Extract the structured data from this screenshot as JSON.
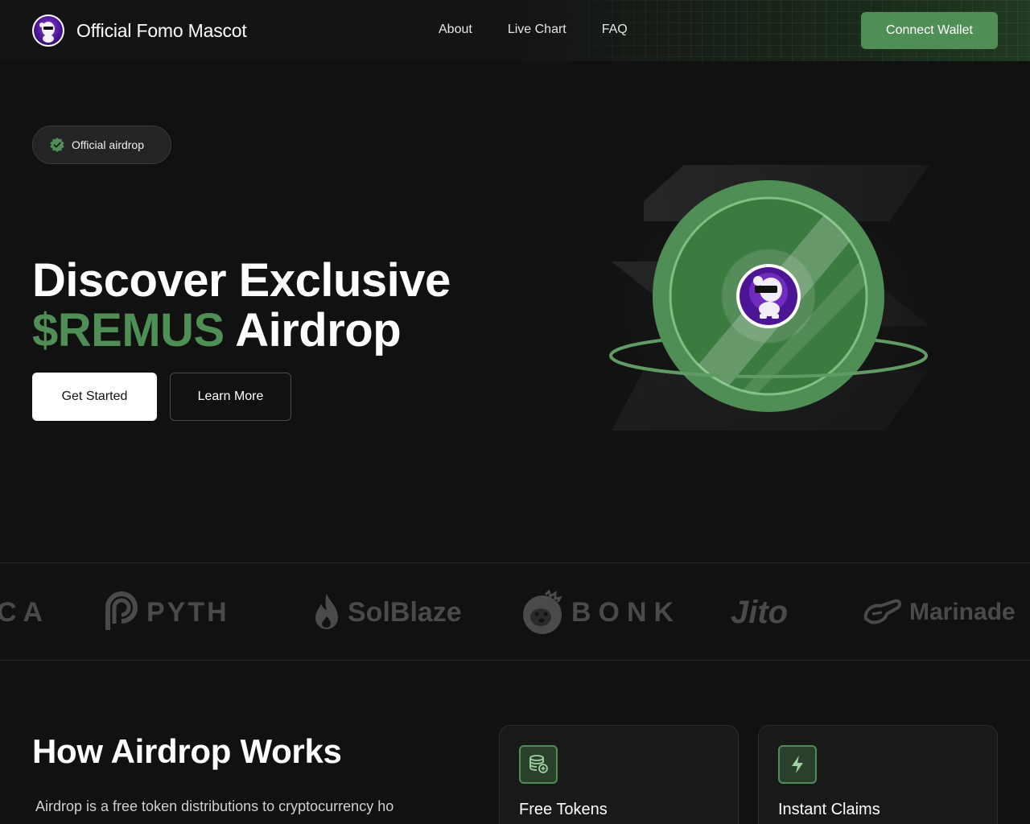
{
  "header": {
    "brand": "Official Fomo Mascot",
    "nav": [
      {
        "label": "About"
      },
      {
        "label": "Live Chart"
      },
      {
        "label": "FAQ"
      }
    ],
    "connect_label": "Connect Wallet"
  },
  "hero": {
    "badge": "Official airdrop",
    "title_line1": "Discover Exclusive",
    "title_accent": "$REMUS",
    "title_rest": "Airdrop",
    "primary_cta": "Get Started",
    "secondary_cta": "Learn More"
  },
  "partners": [
    {
      "name": "CA",
      "icon": "partial-logo"
    },
    {
      "name": "PYTH",
      "icon": "pyth-logo"
    },
    {
      "name": "SolBlaze",
      "icon": "flame-logo"
    },
    {
      "name": "BONK",
      "icon": "bonk-dog-logo"
    },
    {
      "name": "Jito",
      "icon": "jito-logo"
    },
    {
      "name": "Marinade",
      "icon": "marinade-logo"
    }
  ],
  "how": {
    "title": "How Airdrop Works",
    "text": "Airdrop is a free token distributions to cryptocurrency ho",
    "cards": [
      {
        "title": "Free Tokens",
        "icon": "coins-icon"
      },
      {
        "title": "Instant Claims",
        "icon": "lightning-icon"
      }
    ]
  },
  "colors": {
    "accent": "#4f8f55",
    "background": "#111111"
  }
}
